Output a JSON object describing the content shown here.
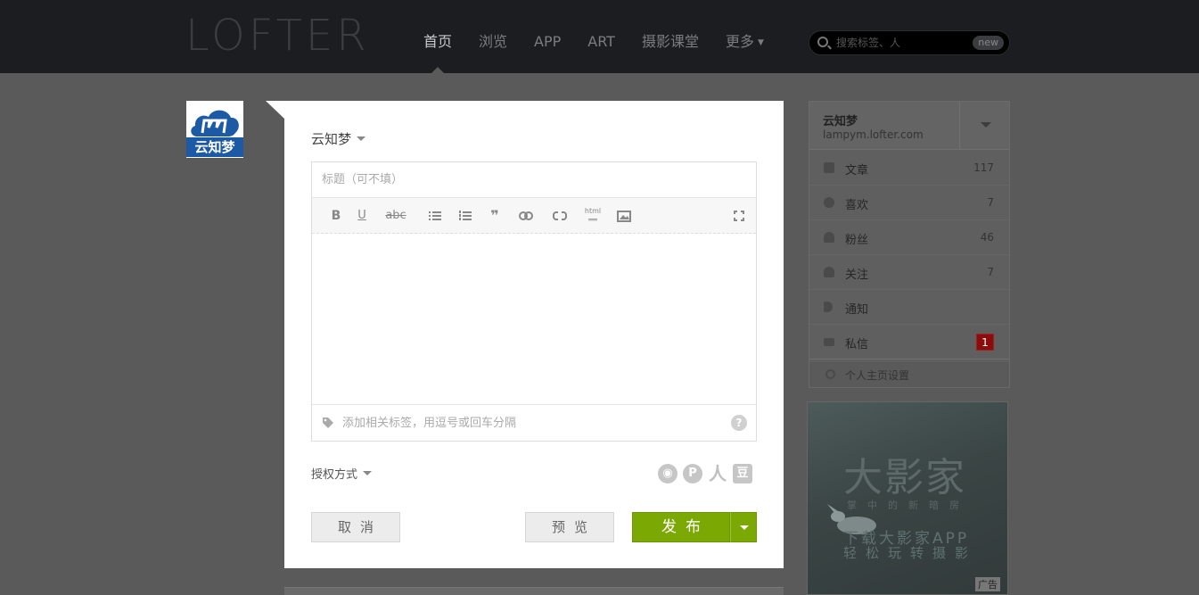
{
  "app": {
    "logo": "LOFTER"
  },
  "nav": {
    "items": [
      {
        "label": "首页",
        "active": true
      },
      {
        "label": "浏览"
      },
      {
        "label": "APP"
      },
      {
        "label": "ART"
      },
      {
        "label": "摄影课堂"
      },
      {
        "label": "更多",
        "has_dropdown": true
      }
    ],
    "search": {
      "placeholder": "搜索标签、人",
      "badge": "new"
    }
  },
  "avatar": {
    "text": "云知梦",
    "brand_color": "#1d5aa5"
  },
  "editor": {
    "blog_selector": "云知梦",
    "title_placeholder": "标题（可不填）",
    "toolbar": {
      "bold_icon": "bold-icon",
      "underline_icon": "underline-icon",
      "strike_label": "abc",
      "html_label": "html"
    },
    "tags_placeholder": "添加相关标签，用逗号或回车分隔",
    "help": "?",
    "license_label": "授权方式",
    "share": [
      "weibo-icon",
      "pinterest-icon",
      "renren-icon",
      "douban-icon"
    ],
    "buttons": {
      "cancel": "取消",
      "preview": "预览",
      "publish": "发布"
    },
    "accent": "#7ca804"
  },
  "profile": {
    "name": "云知梦",
    "url": "lampym.lofter.com",
    "stats": [
      {
        "label": "文章",
        "count": "117"
      },
      {
        "label": "喜欢",
        "count": "7"
      },
      {
        "label": "粉丝",
        "count": "46"
      },
      {
        "label": "关注",
        "count": "7"
      },
      {
        "label": "通知",
        "count": ""
      },
      {
        "label": "私信",
        "badge": "1"
      }
    ],
    "settings_label": "个人主页设置",
    "badge_color": "#8a0c0c"
  },
  "ad": {
    "title": "大影家",
    "subtitle": "掌中的新暗房",
    "line1": "下载大影家APP",
    "line2": "轻松玩转摄影",
    "label": "广告"
  }
}
